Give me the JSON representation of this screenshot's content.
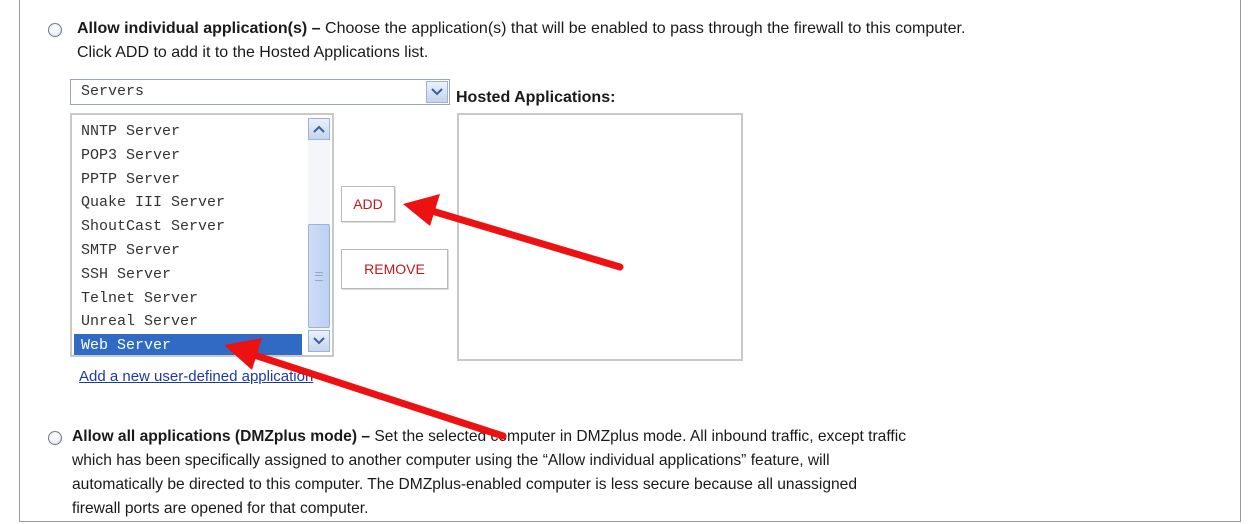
{
  "section_individual": {
    "title": "Allow individual application(s)",
    "dash": " – ",
    "line1_rest": "Choose the application(s) that will be enabled to pass through the firewall to this computer.",
    "line2": "Click ADD to add it to the Hosted Applications list.",
    "category_select": {
      "value": "Servers"
    },
    "hosted_label": "Hosted Applications:",
    "app_list": {
      "items": [
        "NNTP Server",
        "POP3 Server",
        "PPTP Server",
        "Quake III Server",
        "ShoutCast Server",
        "SMTP Server",
        "SSH Server",
        "Telnet Server",
        "Unreal Server",
        "Web Server"
      ],
      "selected": "Web Server"
    },
    "add_label": "ADD",
    "remove_label": "REMOVE",
    "add_link": "Add a new user-defined application"
  },
  "section_all": {
    "title": "Allow all applications (DMZplus mode)",
    "dash": " – ",
    "line1_rest": "Set the selected computer in DMZplus mode. All inbound traffic, except traffic",
    "line2": "which has been specifically assigned to another computer using the “Allow individual applications” feature, will",
    "line3": "automatically be directed to this computer. The DMZplus-enabled computer is less secure because all unassigned",
    "line4": "firewall ports are opened for that computer."
  },
  "icons": {
    "dropdown": "chevron-down-icon",
    "scroll_up": "chevron-up-icon",
    "scroll_down": "chevron-down-icon",
    "annotation": "red-arrow"
  },
  "colors": {
    "selection": "#316ac5",
    "button_text": "#c0181e",
    "link": "#1c3aa8",
    "annotation_arrow": "#ee1111"
  }
}
